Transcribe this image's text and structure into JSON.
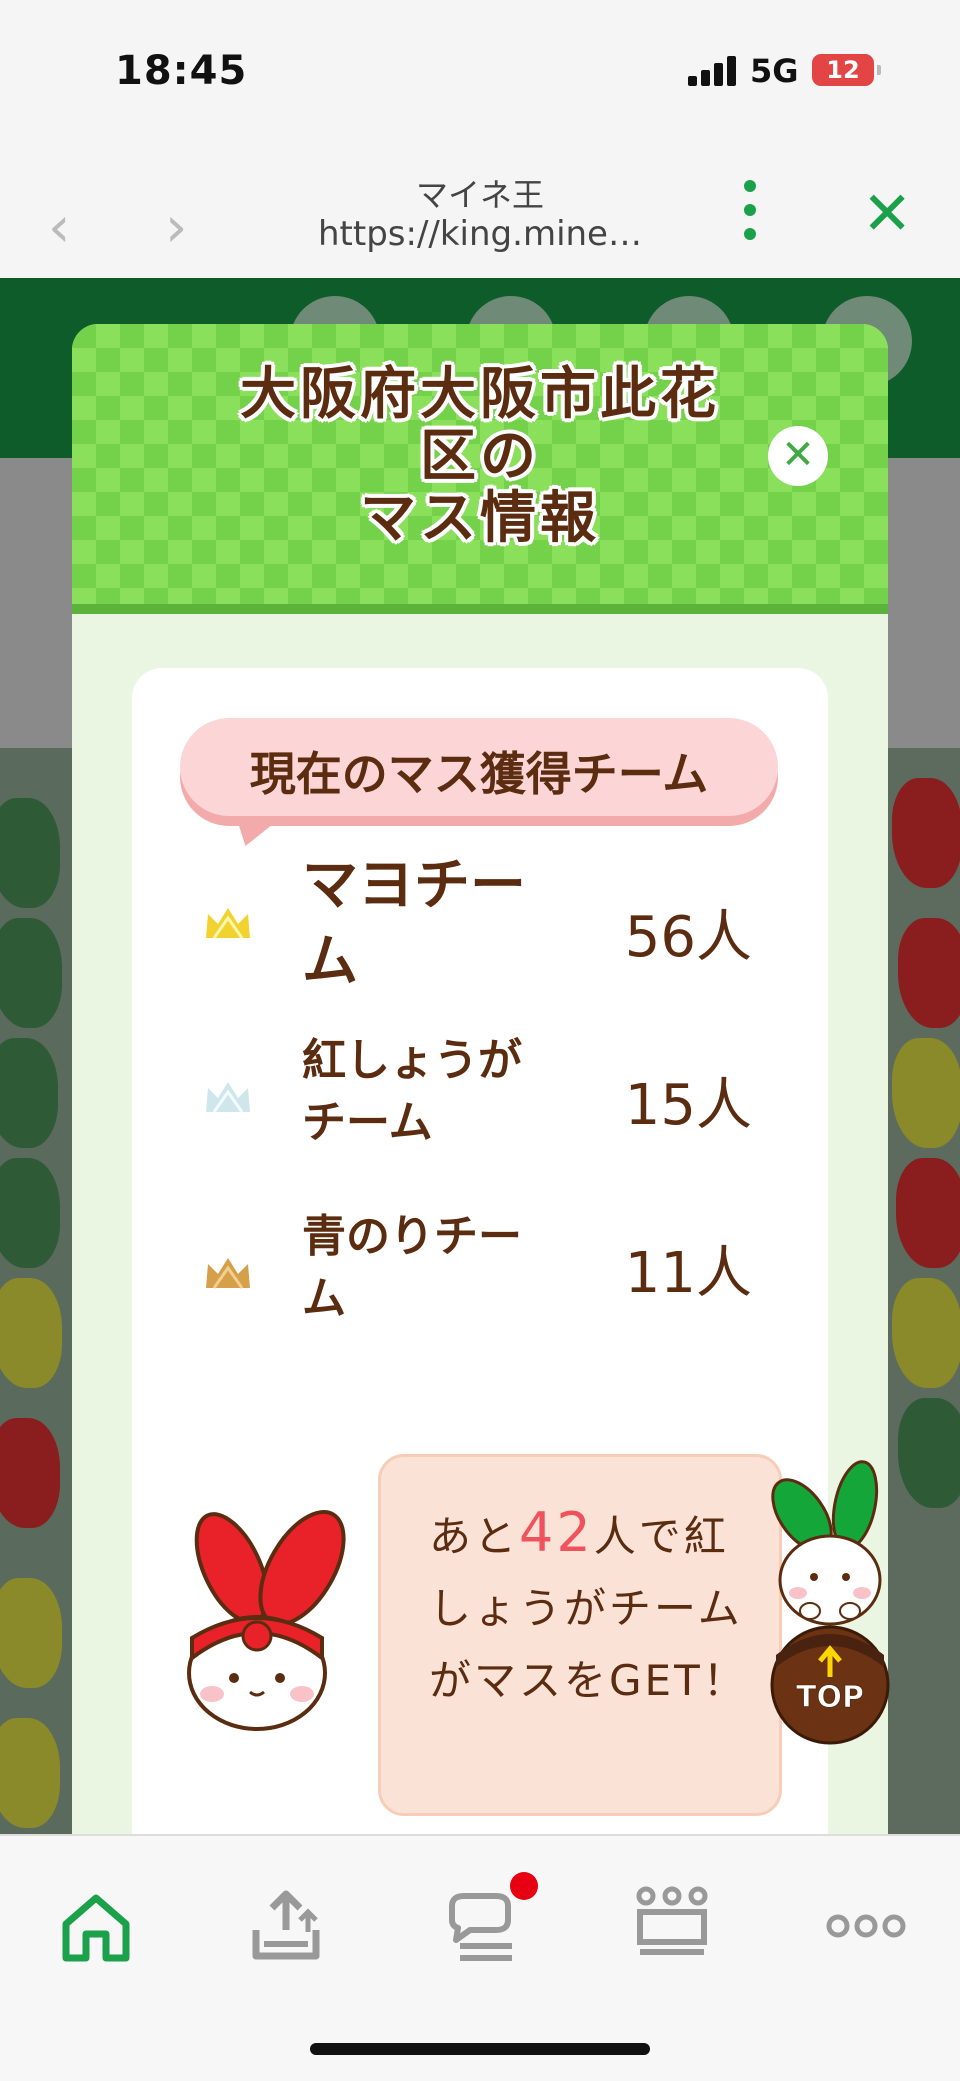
{
  "status_bar": {
    "time": "18:45",
    "network": "5G",
    "battery": "12"
  },
  "browser": {
    "title": "マイネ王",
    "url": "https://king.mine…"
  },
  "modal": {
    "title_line1": "大阪府大阪市此花",
    "title_line2": "区の",
    "title_line3": "マス情報",
    "heading": "現在のマス獲得チーム",
    "teams": [
      {
        "name": "マヨチーム",
        "count": "56人",
        "rank": "gold"
      },
      {
        "name": "紅しょうがチーム",
        "count": "15人",
        "rank": "silver"
      },
      {
        "name": "青のりチーム",
        "count": "11人",
        "rank": "bronze"
      }
    ],
    "note": {
      "prefix": "あと",
      "number": "42",
      "suffix": "人で紅しょうがチームがマスをGET！"
    }
  },
  "top_button": {
    "label": "TOP"
  },
  "nav": {
    "items": [
      {
        "icon": "home-icon",
        "active": true
      },
      {
        "icon": "upload-tray-icon",
        "active": false
      },
      {
        "icon": "chat-icon",
        "active": false,
        "badge": true
      },
      {
        "icon": "crown-icon",
        "active": false
      },
      {
        "icon": "more-icon",
        "active": false
      }
    ]
  },
  "colors": {
    "accent_green": "#1aa14a",
    "brown_text": "#5b2c10",
    "number_red": "#f0525c",
    "badge_red": "#e60012"
  }
}
